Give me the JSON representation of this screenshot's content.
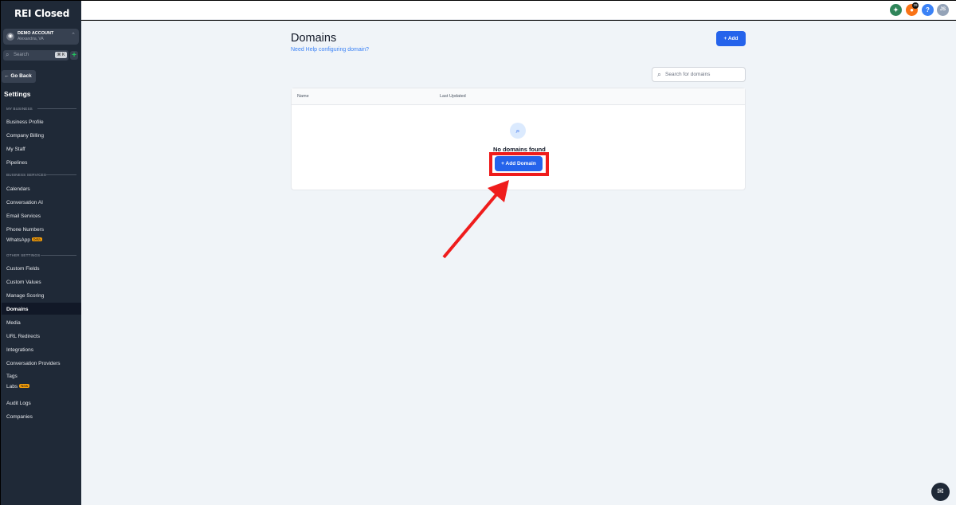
{
  "app": {
    "logo": "REI Closed"
  },
  "account": {
    "name": "DEMO ACCOUNT",
    "location": "Alexandria, VA"
  },
  "sidebar_search": {
    "placeholder": "Search",
    "shortcut": "⌘ K"
  },
  "go_back": "Go Back",
  "settings_title": "Settings",
  "sections": {
    "my_business": "MY BUSINESS",
    "business_services": "BUSINESS SERVICES",
    "other_settings": "OTHER SETTINGS"
  },
  "nav": {
    "business_profile": "Business Profile",
    "company_billing": "Company Billing",
    "my_staff": "My Staff",
    "pipelines": "Pipelines",
    "calendars": "Calendars",
    "conversation_ai": "Conversation AI",
    "email_services": "Email Services",
    "phone_numbers": "Phone Numbers",
    "whatsapp": "WhatsApp",
    "whatsapp_badge": "beta",
    "custom_fields": "Custom Fields",
    "custom_values": "Custom Values",
    "manage_scoring": "Manage Scoring",
    "domains": "Domains",
    "media": "Media",
    "url_redirects": "URL Redirects",
    "integrations": "Integrations",
    "conversation_providers": "Conversation Providers",
    "tags": "Tags",
    "labs": "Labs",
    "labs_badge": "New",
    "audit_logs": "Audit Logs",
    "companies": "Companies"
  },
  "topbar": {
    "notification_count": "29",
    "help": "?",
    "avatar": "JS"
  },
  "page": {
    "title": "Domains",
    "help_link": "Need Help configuring domain?",
    "add_button": "Add",
    "search_placeholder": "Search for domains",
    "columns": [
      "Name",
      "Last Updated"
    ],
    "empty_text": "No domains found",
    "add_domain_button": "Add Domain"
  },
  "colors": {
    "accent": "#2563eb",
    "annotation": "#ef1c1c",
    "sidebar": "#1f2937"
  }
}
